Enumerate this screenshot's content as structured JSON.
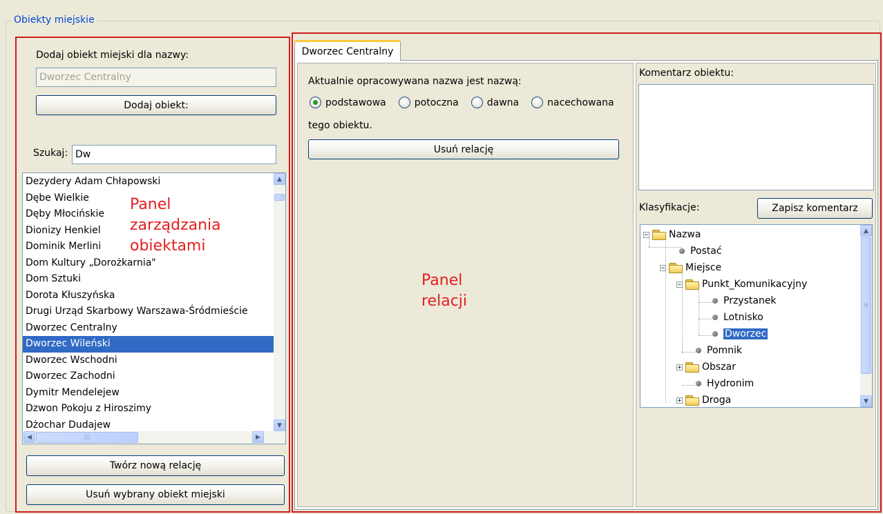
{
  "group": {
    "title": "Obiekty miejskie"
  },
  "left_panel": {
    "add_label": "Dodaj obiekt miejski dla nazwy:",
    "name_value": "Dworzec Centralny",
    "add_button": "Dodaj obiekt:",
    "search_label": "Szukaj:",
    "search_value": "Dw",
    "items": [
      "Dezydery Adam Chłapowski",
      "Dębe Wielkie",
      "Dęby Młocińskie",
      "Dionizy Henkiel",
      "Dominik Merlini",
      "Dom Kultury „Dorożkarnia\"",
      "Dom Sztuki",
      "Dorota Kłuszyńska",
      "Drugi Urząd Skarbowy Warszawa-Śródmieście",
      "Dworzec Centralny",
      "Dworzec Wileński",
      "Dworzec Wschodni",
      "Dworzec Zachodni",
      "Dymitr Mendelejew",
      "Dzwon Pokoju z Hiroszimy",
      "Dżochar Dudajew"
    ],
    "selected_index": 10,
    "create_relation_button": "Twórz nową relację",
    "delete_object_button": "Usuń wybrany obiekt miejski",
    "annotation": [
      "Panel",
      "zarządzania",
      "obiektami"
    ]
  },
  "right_panel": {
    "tab_label": "Dworzec Centralny",
    "name_type_prompt": "Aktualnie opracowywana nazwa jest nazwą:",
    "radio_options": [
      "podstawowa",
      "potoczna",
      "dawna",
      "nacechowana"
    ],
    "radio_selected": "podstawowa",
    "suffix_text": "tego obiektu.",
    "remove_relation_button": "Usuń relację",
    "annotation": [
      "Panel",
      "relacji"
    ],
    "comment_label": "Komentarz obiektu:",
    "comment_value": "",
    "classification_label": "Klasyfikacje:",
    "save_comment_button": "Zapisz komentarz",
    "tree": [
      {
        "label": "Nazwa",
        "kind": "folder",
        "expander": "−"
      },
      {
        "label": "Postać",
        "kind": "leaf"
      },
      {
        "label": "Miejsce",
        "kind": "folder",
        "expander": "−"
      },
      {
        "label": "Punkt_Komunikacyjny",
        "kind": "folder",
        "expander": "−"
      },
      {
        "label": "Przystanek",
        "kind": "leaf"
      },
      {
        "label": "Lotnisko",
        "kind": "leaf"
      },
      {
        "label": "Dworzec",
        "kind": "leaf",
        "selected": true
      },
      {
        "label": "Pomnik",
        "kind": "leaf"
      },
      {
        "label": "Obszar",
        "kind": "folder",
        "expander": "+"
      },
      {
        "label": "Hydronim",
        "kind": "leaf"
      },
      {
        "label": "Droga",
        "kind": "folder",
        "expander": "+"
      }
    ]
  },
  "colors": {
    "background": "#ece9d8",
    "annotation_red": "#e21f1f",
    "selection_blue": "#316ac5",
    "group_title_blue": "#0046d5",
    "radio_green": "#21a121"
  }
}
